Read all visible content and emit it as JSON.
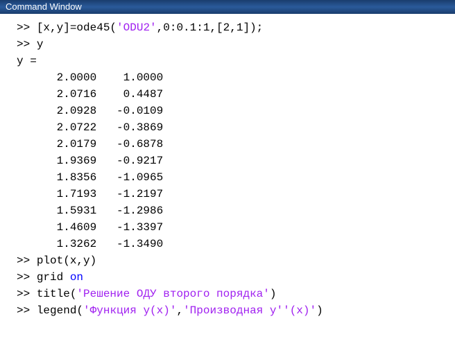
{
  "window": {
    "title": "Command Window"
  },
  "prompt": ">> ",
  "lines": {
    "cmd1_pre": "[x,y]=ode45(",
    "cmd1_str": "'ODU2'",
    "cmd1_post": ",0:0.1:1,[2,1]);",
    "cmd2": "y",
    "out_header": "y =",
    "rows": [
      "      2.0000    1.0000",
      "      2.0716    0.4487",
      "      2.0928   -0.0109",
      "      2.0722   -0.3869",
      "      2.0179   -0.6878",
      "      1.9369   -0.9217",
      "      1.8356   -1.0965",
      "      1.7193   -1.2197",
      "      1.5931   -1.2986",
      "      1.4609   -1.3397",
      "      1.3262   -1.3490"
    ],
    "cmd3": "plot(x,y)",
    "cmd4_pre": "grid ",
    "cmd4_kw": "on",
    "cmd5_pre": "title(",
    "cmd5_str": "'Решение ОДУ второго порядка'",
    "cmd5_post": ")",
    "cmd6_pre": "legend(",
    "cmd6_str1": "'Функция y(x)'",
    "cmd6_mid": ",",
    "cmd6_str2": "'Производная y''(x)'",
    "cmd6_post": ")"
  }
}
